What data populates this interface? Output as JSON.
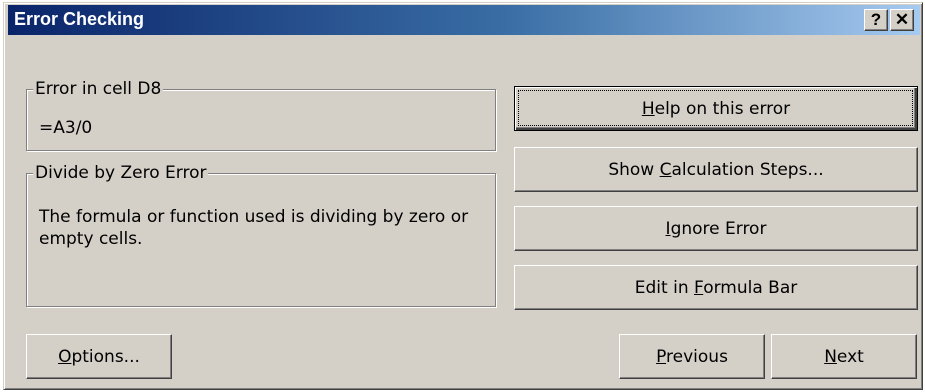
{
  "window": {
    "title": "Error Checking",
    "help_glyph": "?",
    "close_glyph": "✕"
  },
  "error_location": {
    "label": "Error in cell D8",
    "formula": "=A3/0"
  },
  "error_type": {
    "label": "Divide by Zero Error",
    "description": "The formula or function used is dividing by zero or empty cells."
  },
  "buttons": {
    "help": {
      "pre": "",
      "key": "H",
      "post": "elp on this error"
    },
    "calc_steps": {
      "pre": "Show ",
      "key": "C",
      "post": "alculation Steps..."
    },
    "ignore": {
      "pre": "",
      "key": "I",
      "post": "gnore Error"
    },
    "edit_formula": {
      "pre": "Edit in ",
      "key": "F",
      "post": "ormula Bar"
    },
    "options": {
      "pre": "",
      "key": "O",
      "post": "ptions..."
    },
    "previous": {
      "pre": "",
      "key": "P",
      "post": "revious"
    },
    "next": {
      "pre": "",
      "key": "N",
      "post": "ext"
    }
  },
  "colors": {
    "title_gradient_start": "#0a246a",
    "title_gradient_end": "#a6caf0",
    "dialog_face": "#d4d0c8"
  }
}
